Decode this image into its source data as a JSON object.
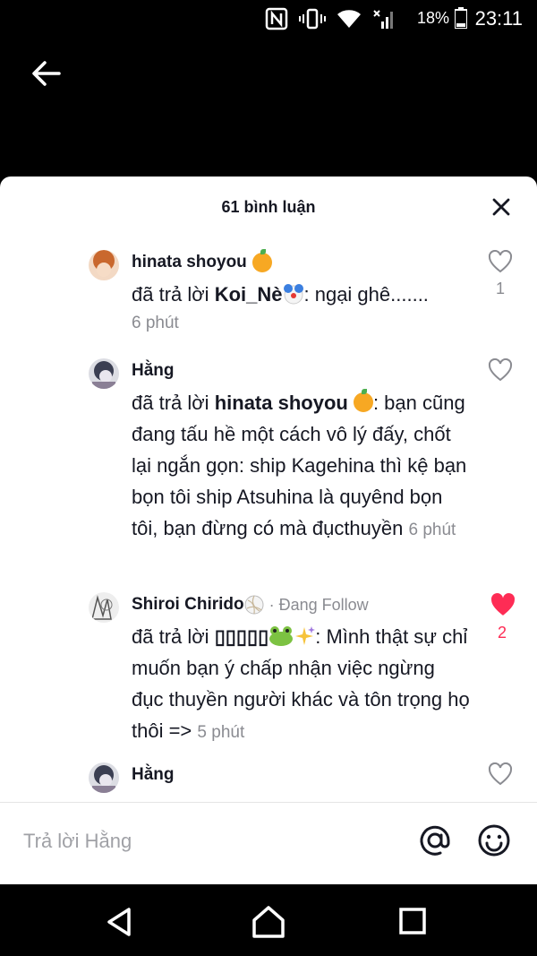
{
  "status": {
    "time": "23:11",
    "battery": "18%"
  },
  "sheet": {
    "title": "61 bình luận"
  },
  "comments": [
    {
      "username": "hinata shoyou",
      "reply_prefix": "đã trả lời",
      "reply_to": "Koi_Nè",
      "text": ": ngại ghê.......",
      "time": "6 phút",
      "likes": "1"
    },
    {
      "username": "Hằng",
      "reply_prefix": "đã trả lời",
      "reply_to": "hinata shoyou",
      "text": ": bạn cũng đang tấu hề một cách vô lý đấy, chốt lại ngắn gọn: ship Kagehina thì kệ bạn bọn tôi ship Atsuhina là quyênd bọn tôi, bạn đừng có mà đụcthuyền",
      "time": "6 phút",
      "likes": ""
    },
    {
      "username": "Shiroi Chirido",
      "following": "· Đang Follow",
      "reply_prefix": "đã trả lời",
      "reply_to": "▯▯▯▯▯",
      "text": ": Mình thật sự chỉ muốn bạn ý chấp nhận việc ngừng đục thuyền người khác và tôn trọng họ thôi =>",
      "time": "5 phút",
      "likes": "2"
    },
    {
      "username": "Hằng"
    }
  ],
  "reply_bar": {
    "placeholder": "Trả lời Hằng"
  },
  "colors": {
    "liked": "#fe2c55",
    "text": "#161823",
    "muted": "#8a8b91"
  }
}
